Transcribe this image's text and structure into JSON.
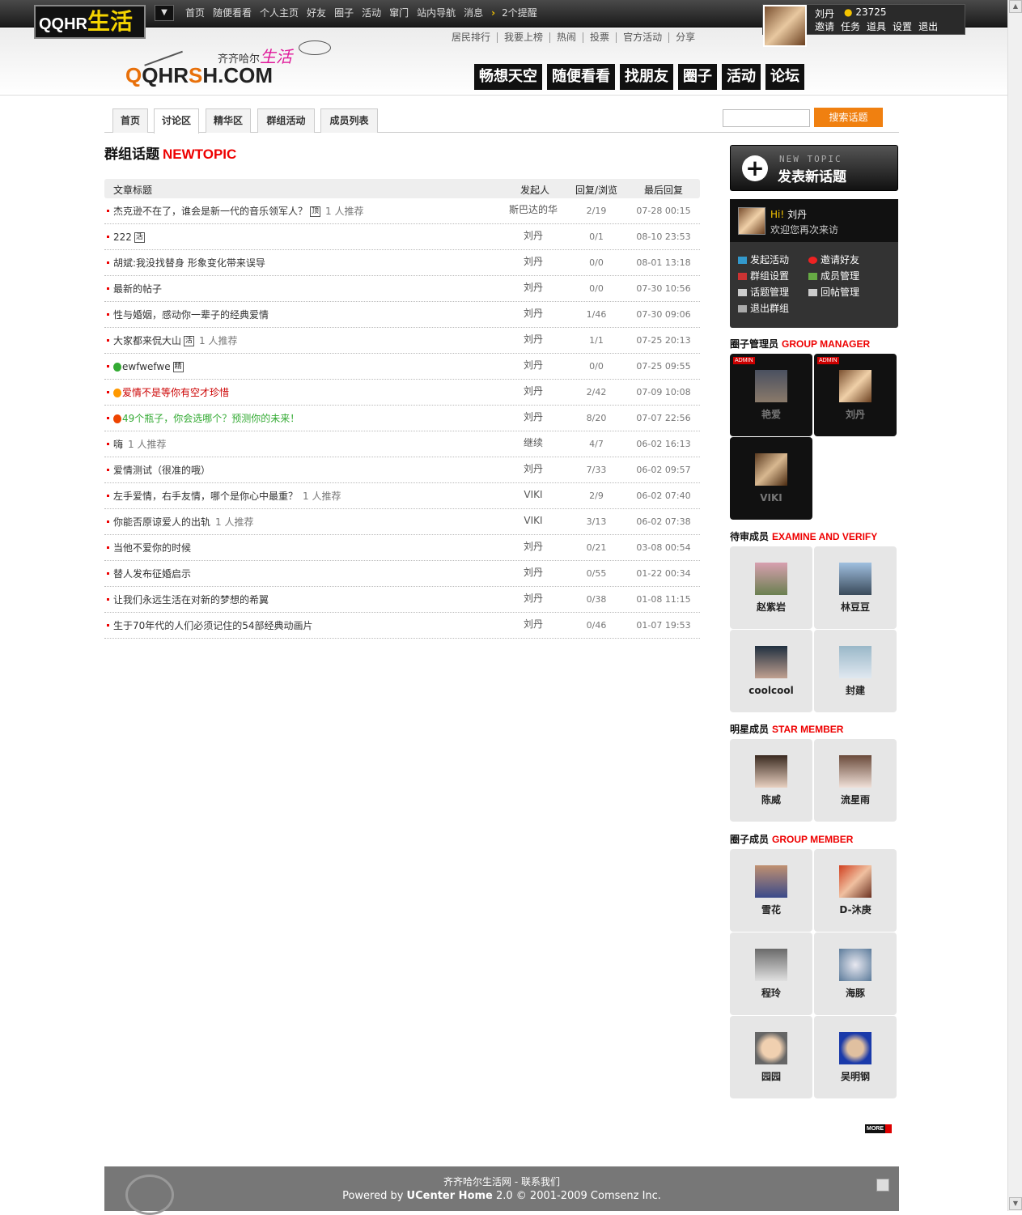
{
  "topbar": {
    "logo_main": "QQHR",
    "logo_life": "生活",
    "nav": [
      "首页",
      "随便看看",
      "个人主页",
      "好友",
      "圈子",
      "活动",
      "窜门",
      "站内导航",
      "消息"
    ],
    "remind": "2个提醒",
    "user": {
      "name": "刘丹",
      "credit": "23725",
      "links": [
        "邀请",
        "任务",
        "道具",
        "设置",
        "退出"
      ]
    }
  },
  "header": {
    "logo_domain_a": "Q",
    "logo_domain_b": "QHR",
    "logo_domain_c": "S",
    "logo_domain_d": "H.COM",
    "logo_city": "齐齐哈尔",
    "logo_life": "生活",
    "subnav": [
      "居民排行",
      "我要上榜",
      "热闹",
      "投票",
      "官方活动",
      "分享"
    ],
    "mainnav": [
      "畅想天空",
      "随便看看",
      "找朋友",
      "圈子",
      "活动",
      "论坛"
    ]
  },
  "tabs": [
    "首页",
    "讨论区",
    "精华区",
    "群组活动",
    "成员列表"
  ],
  "search": {
    "button": "搜索话题",
    "placeholder": ""
  },
  "section": {
    "title": "群组话题",
    "title_en": "NEWTOPIC"
  },
  "table": {
    "headers": [
      "文章标题",
      "发起人",
      "回复/浏览",
      "最后回复"
    ],
    "rows": [
      {
        "title": "杰克逊不在了，谁会是新一代的音乐领军人？",
        "flag": "顶",
        "rec": "1 人推荐",
        "author": "斯巴达的华",
        "count": "2/19",
        "last": "07-28 00:15"
      },
      {
        "title": "222",
        "flag": "活",
        "rec": "",
        "author": "刘丹",
        "count": "0/1",
        "last": "08-10 23:53"
      },
      {
        "title": "胡斌:我没找替身 形象变化带来误导",
        "flag": "",
        "rec": "",
        "author": "刘丹",
        "count": "0/0",
        "last": "08-01 13:18"
      },
      {
        "title": "最新的帖子",
        "flag": "",
        "rec": "",
        "author": "刘丹",
        "count": "0/0",
        "last": "07-30 10:56"
      },
      {
        "title": "性与婚姻，感动你一辈子的经典爱情",
        "flag": "",
        "rec": "",
        "author": "刘丹",
        "count": "1/46",
        "last": "07-30 09:06"
      },
      {
        "title": "大家都来侃大山",
        "flag": "活",
        "rec": "1 人推荐",
        "author": "刘丹",
        "count": "1/1",
        "last": "07-25 20:13"
      },
      {
        "title": "ewfwefwe",
        "flag": "精",
        "rec": "",
        "author": "刘丹",
        "count": "0/0",
        "last": "07-25 09:55"
      },
      {
        "title": "爱情不是等你有空才珍惜",
        "flag": "",
        "rec": "",
        "author": "刘丹",
        "count": "2/42",
        "last": "07-09 10:08"
      },
      {
        "title": "49个瓶子，你会选哪个？预测你的未来！",
        "flag": "",
        "rec": "",
        "author": "刘丹",
        "count": "8/20",
        "last": "07-07 22:56"
      },
      {
        "title": "嗨",
        "flag": "",
        "rec": "1 人推荐",
        "author": "继续",
        "count": "4/7",
        "last": "06-02 16:13"
      },
      {
        "title": "爱情测试（很准的哦）",
        "flag": "",
        "rec": "",
        "author": "刘丹",
        "count": "7/33",
        "last": "06-02 09:57"
      },
      {
        "title": "左手爱情，右手友情，哪个是你心中最重？",
        "flag": "",
        "rec": "1 人推荐",
        "author": "VIKI",
        "count": "2/9",
        "last": "06-02 07:40"
      },
      {
        "title": "你能否原谅爱人的出轨",
        "flag": "",
        "rec": "1 人推荐",
        "author": "VIKI",
        "count": "3/13",
        "last": "06-02 07:38"
      },
      {
        "title": "当他不爱你的时候",
        "flag": "",
        "rec": "",
        "author": "刘丹",
        "count": "0/21",
        "last": "03-08 00:54"
      },
      {
        "title": "替人发布征婚启示",
        "flag": "",
        "rec": "",
        "author": "刘丹",
        "count": "0/55",
        "last": "01-22 00:34"
      },
      {
        "title": "让我们永远生活在对新的梦想的希翼",
        "flag": "",
        "rec": "",
        "author": "刘丹",
        "count": "0/38",
        "last": "01-08 11:15"
      },
      {
        "title": "生于70年代的人们必须记住的54部经典动画片",
        "flag": "",
        "rec": "",
        "author": "刘丹",
        "count": "0/46",
        "last": "01-07 19:53"
      }
    ]
  },
  "newtopic": {
    "en": "NEW TOPIC",
    "zh": "发表新话题"
  },
  "welcome": {
    "hi": "Hi!",
    "name": "刘丹",
    "msg": "欢迎您再次来访",
    "actions": [
      "发起活动",
      "邀请好友",
      "群组设置",
      "成员管理",
      "话题管理",
      "回帖管理",
      "退出群组"
    ]
  },
  "managers": {
    "title": "圈子管理员",
    "title_en": "GROUP MANAGER",
    "badge": "ADMIN",
    "members": [
      "艳爱",
      "刘丹",
      "VIKI"
    ]
  },
  "pending": {
    "title": "待审成员",
    "title_en": "EXAMINE AND VERIFY",
    "members": [
      "赵紫岩",
      "林豆豆",
      "coolcool",
      "封建"
    ]
  },
  "stars": {
    "title": "明星成员",
    "title_en": "STAR MEMBER",
    "members": [
      "陈威",
      "流星雨"
    ]
  },
  "group_members": {
    "title": "圈子成员",
    "title_en": "GROUP MEMBER",
    "members": [
      "雪花",
      "D-沐庚",
      "程玲",
      "海豚",
      "园园",
      "吴明钢"
    ]
  },
  "more": "MORE",
  "footer": {
    "line1": "齐齐哈尔生活网 - 联系我们",
    "powered": "Powered by ",
    "product": "UCenter Home",
    "rest": " 2.0 © 2001-2009 Comsenz Inc."
  },
  "colors": {
    "accent": "#e00000",
    "button": "#f08010",
    "topbar": "#1a1a1a"
  }
}
